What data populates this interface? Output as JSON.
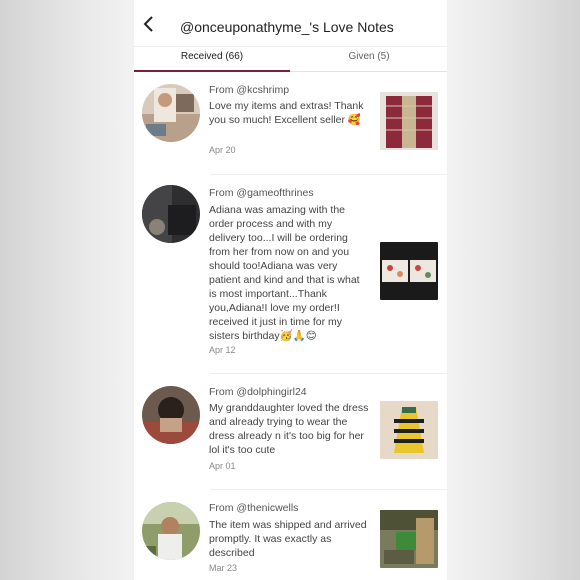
{
  "header": {
    "title": "@onceuponathyme_'s Love Notes"
  },
  "tabs": [
    {
      "label": "Received (66)",
      "active": true
    },
    {
      "label": "Given (5)",
      "active": false
    }
  ],
  "accent_color": "#7a1f3d",
  "notes": [
    {
      "from": "From @kcshrimp",
      "message": "Love my items and extras! Thank you so much! Excellent seller 🥰",
      "date": "Apr 20"
    },
    {
      "from": "From @gameofthrines",
      "message": "Adiana was amazing with the order process and with my delivery too...I will be ordering from her from now on and you should too!Adiana was very patient and kind and that is what is most important...Thank you,Adiana!I love my order!I received it just in time for my sisters birthday🥳🙏😊",
      "date": "Apr 12"
    },
    {
      "from": "From @dolphingirl24",
      "message": "My granddaughter loved the dress and already trying to wear the dress already n it's too big for her lol it's too cute",
      "date": "Apr 01"
    },
    {
      "from": "From @thenicwells",
      "message": "The item was shipped and arrived promptly. It was exactly as described",
      "date": "Mar 23"
    }
  ]
}
